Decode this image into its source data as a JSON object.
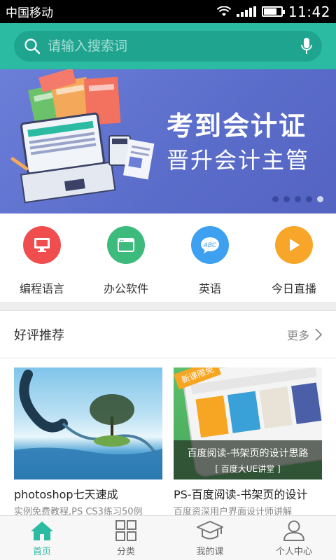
{
  "status_bar": {
    "carrier": "中国移动",
    "time": "11:42"
  },
  "search": {
    "placeholder": "请输入搜索词"
  },
  "banner": {
    "title_line1": "考到会计证",
    "title_line2": "晋升会计主管",
    "slide_count": 5,
    "active_slide": 5
  },
  "categories": [
    {
      "label": "编程语言",
      "icon": "monitor-icon",
      "color": "#f04e4e"
    },
    {
      "label": "办公软件",
      "icon": "window-icon",
      "color": "#3dbb7d"
    },
    {
      "label": "英语",
      "icon": "abc-bubble-icon",
      "color": "#3ea0f0"
    },
    {
      "label": "今日直播",
      "icon": "play-icon",
      "color": "#f8a62a"
    }
  ],
  "section": {
    "title": "好评推荐",
    "more_label": "更多"
  },
  "courses": [
    {
      "title": "photoshop七天速成",
      "desc": "实例免费教程,PS CS3练习50例"
    },
    {
      "title": "PS-百度阅读-书架页的设计",
      "desc": "百度资深用户界面设计师讲解",
      "overlay_title": "百度阅读-书架页的设计思路",
      "overlay_sub": "[ 百度大UE讲堂 ]",
      "badge": "新课限免"
    }
  ],
  "bottom_nav": [
    {
      "label": "首页",
      "active": true
    },
    {
      "label": "分类",
      "active": false
    },
    {
      "label": "我的课",
      "active": false
    },
    {
      "label": "个人中心",
      "active": false
    }
  ],
  "colors": {
    "accent": "#2bbba3",
    "banner_bg": "#5f70cc"
  }
}
